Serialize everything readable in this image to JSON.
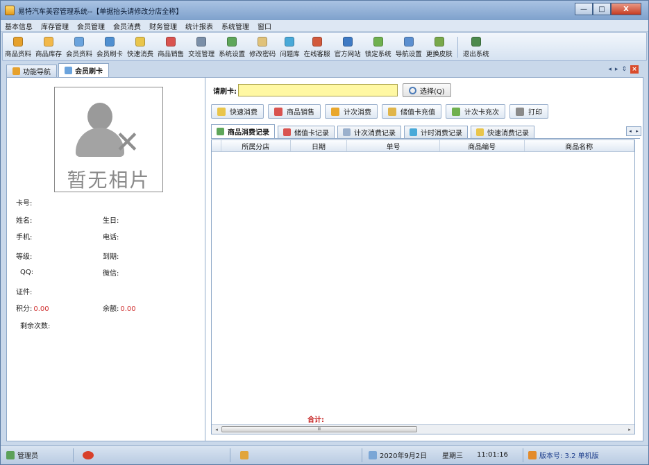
{
  "window": {
    "title": "易特汽车美容管理系统--【单据抬头请修改分店全称】",
    "controls": {
      "minimize": "—",
      "maximize": "□",
      "close": "X"
    }
  },
  "menu": [
    "基本信息",
    "库存管理",
    "会员管理",
    "会员消费",
    "财务管理",
    "统计报表",
    "系统管理",
    "窗口"
  ],
  "toolbar": [
    {
      "label": "商品资料",
      "icon": "goods-icon",
      "color": "#e6a12c"
    },
    {
      "label": "商品库存",
      "icon": "stock-icon",
      "color": "#f2b84a"
    },
    {
      "label": "会员资料",
      "icon": "members-icon",
      "color": "#6aa3dd"
    },
    {
      "label": "会员刷卡",
      "icon": "card-icon",
      "color": "#4f8fd0"
    },
    {
      "label": "快速消费",
      "icon": "quick-icon",
      "color": "#e9c54b"
    },
    {
      "label": "商品销售",
      "icon": "sale-icon",
      "color": "#d9534f"
    },
    {
      "label": "交班管理",
      "icon": "shift-icon",
      "color": "#7b8fa8"
    },
    {
      "label": "系统设置",
      "icon": "settings-icon",
      "color": "#5ea65a"
    },
    {
      "label": "修改密码",
      "icon": "password-icon",
      "color": "#e0c27a"
    },
    {
      "label": "问题库",
      "icon": "question-icon",
      "color": "#49a9d8"
    },
    {
      "label": "在线客服",
      "icon": "service-icon",
      "color": "#d25a3c"
    },
    {
      "label": "官方网站",
      "icon": "website-icon",
      "color": "#3e7ac4"
    },
    {
      "label": "锁定系统",
      "icon": "lock-icon",
      "color": "#6fb04f"
    },
    {
      "label": "导航设置",
      "icon": "nav-icon",
      "color": "#5b8fd0"
    },
    {
      "label": "更换皮肤",
      "icon": "skin-icon",
      "color": "#78a84a"
    },
    {
      "label": "退出系统",
      "icon": "exit-icon",
      "color": "#4d8a4d"
    }
  ],
  "tabs": [
    {
      "label": "功能导航",
      "active": false
    },
    {
      "label": "会员刷卡",
      "active": true
    }
  ],
  "tabnav": {
    "prev": "◂",
    "next": "▸",
    "pin": "⇕",
    "close": "×"
  },
  "member": {
    "photo_text": "暂无相片",
    "card_no": "卡号:",
    "name": "姓名:",
    "birthday": "生日:",
    "mobile": "手机:",
    "phone": "电话:",
    "level": "等级:",
    "expire": "到期:",
    "qq": "QQ:",
    "wechat": "微信:",
    "id_card": "证件:",
    "points_label": "积分:",
    "points_value": "0.00",
    "balance_label": "余额:",
    "balance_value": "0.00",
    "remaining": "剩余次数:"
  },
  "card": {
    "label": "请刷卡:",
    "value": "",
    "select_button": "选择(Q)"
  },
  "actions": [
    "快速消费",
    "商品销售",
    "计次消费",
    "储值卡充值",
    "计次卡充次",
    "打印"
  ],
  "subtabs": [
    {
      "label": "商品消费记录",
      "active": true
    },
    {
      "label": "储值卡记录",
      "active": false
    },
    {
      "label": "计次消费记录",
      "active": false
    },
    {
      "label": "计时消费记录",
      "active": false
    },
    {
      "label": "快速消费记录",
      "active": false
    }
  ],
  "subnav": {
    "prev": "◂",
    "next": "▸"
  },
  "grid": {
    "columns": [
      "所属分店",
      "日期",
      "单号",
      "商品编号",
      "商品名称"
    ],
    "total_label": "合计:",
    "scroll_left": "◂",
    "scroll_thumb": "Ⅲ",
    "scroll_right": "▸"
  },
  "status": {
    "user": "管理员",
    "date": "2020年9月2日",
    "weekday": "星期三",
    "time": "11:01:16",
    "version": "版本号: 3.2 单机版"
  }
}
